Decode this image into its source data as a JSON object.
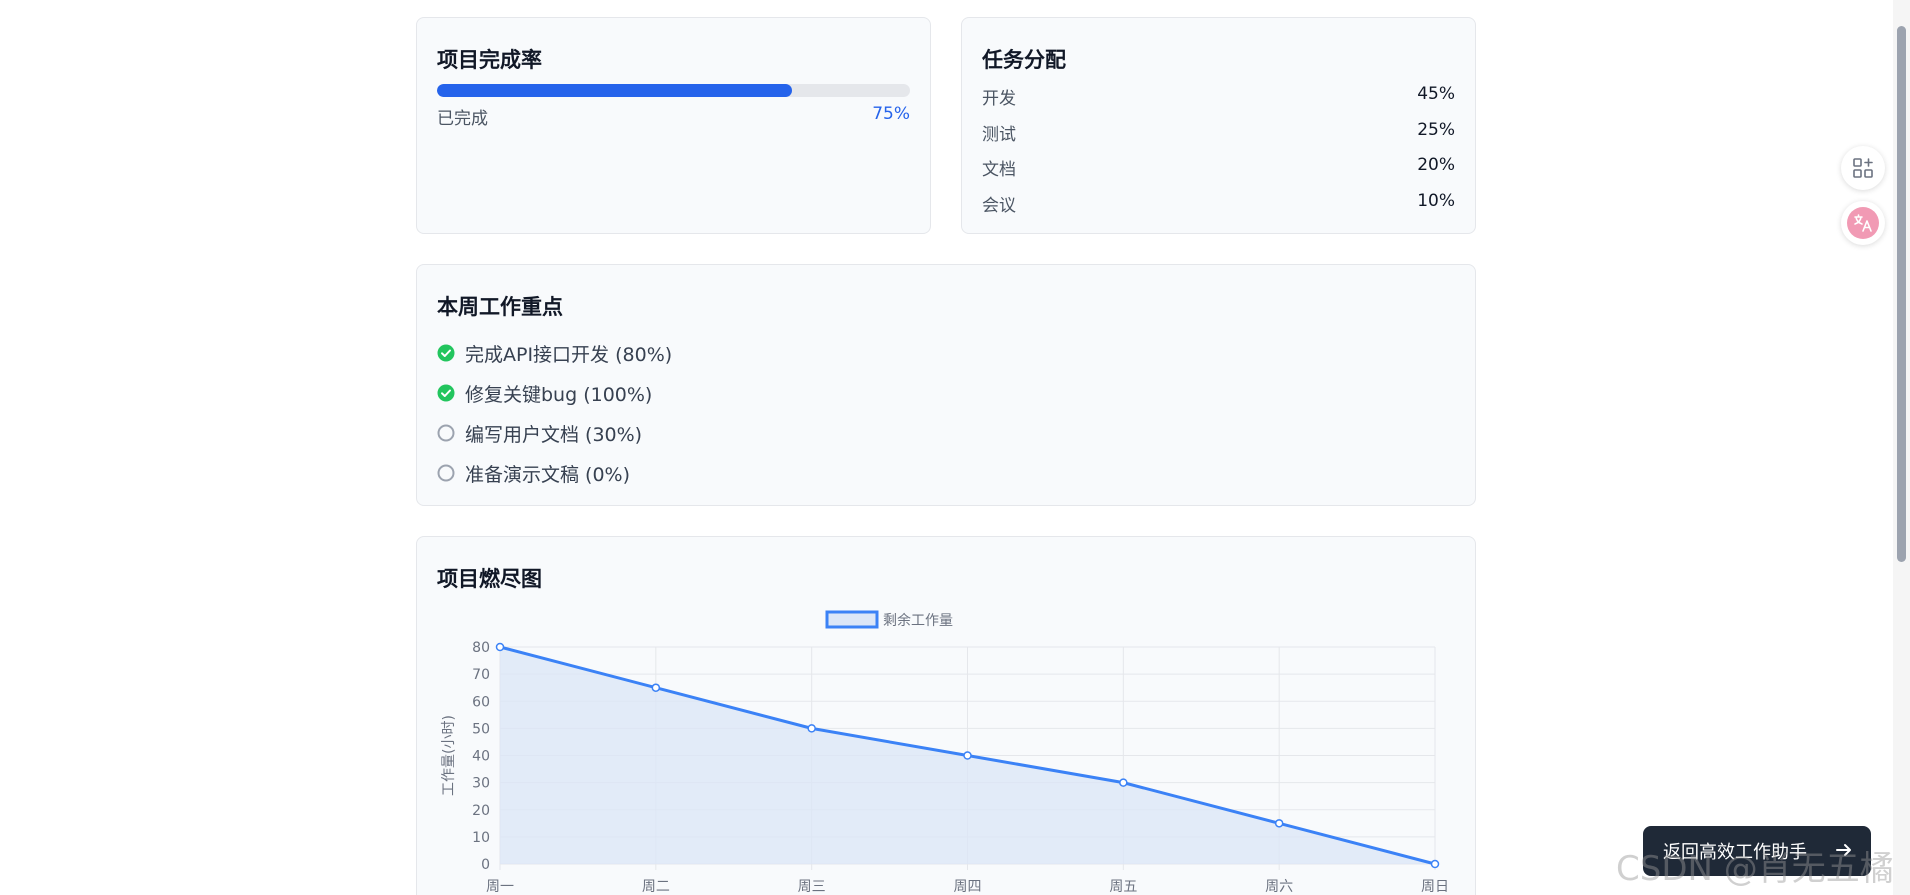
{
  "completion": {
    "title": "项目完成率",
    "label": "已完成",
    "value_text": "75%",
    "progress": 0.75
  },
  "tasks": {
    "title": "任务分配",
    "items": [
      {
        "name": "开发",
        "pct": "45%"
      },
      {
        "name": "测试",
        "pct": "25%"
      },
      {
        "name": "文档",
        "pct": "20%"
      },
      {
        "name": "会议",
        "pct": "10%"
      }
    ]
  },
  "focus": {
    "title": "本周工作重点",
    "items": [
      {
        "text": "完成API接口开发 (80%)",
        "done": true
      },
      {
        "text": "修复关键bug (100%)",
        "done": true
      },
      {
        "text": "编写用户文档 (30%)",
        "done": false
      },
      {
        "text": "准备演示文稿 (0%)",
        "done": false
      }
    ]
  },
  "burndown": {
    "title": "项目燃尽图"
  },
  "chart_data": {
    "type": "line",
    "categories": [
      "周一",
      "周二",
      "周三",
      "周四",
      "周五",
      "周六",
      "周日"
    ],
    "series": [
      {
        "name": "剩余工作量",
        "values": [
          80,
          65,
          50,
          40,
          30,
          15,
          0
        ]
      }
    ],
    "title": "",
    "xlabel": "",
    "ylabel": "工作量(小时)",
    "ylim": [
      0,
      80
    ],
    "yticks": [
      0,
      10,
      20,
      30,
      40,
      50,
      60,
      70,
      80
    ],
    "grid": true,
    "legend": "top-center",
    "fill": true,
    "line_color": "#3b82f6",
    "fill_color": "#dbe6f7"
  },
  "colors": {
    "accent": "#2563eb",
    "done": "#22c55e",
    "pending": "#9ca3af"
  },
  "back_button": {
    "label": "返回高效工作助手",
    "icon": "arrow-right-icon"
  },
  "side_icons": {
    "grid": "apps-add-icon",
    "translate": "translate-icon"
  },
  "watermark": "CSDN @肖无五橘"
}
